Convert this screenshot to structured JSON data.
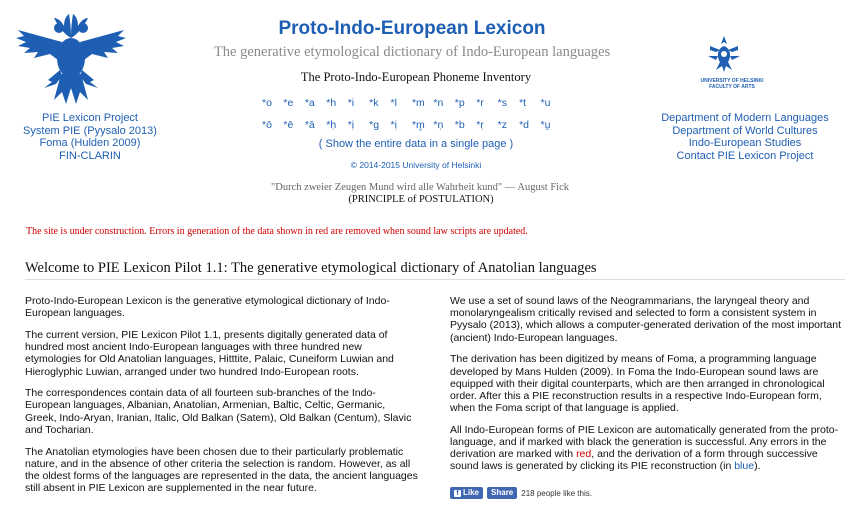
{
  "header": {
    "title": "Proto-Indo-European Lexicon",
    "subtitle": "The generative etymological dictionary of Indo-European languages",
    "inventory_title": "The Proto-Indo-European Phoneme Inventory",
    "phonemes_row1": [
      "*o",
      "*e",
      "*a",
      "*h",
      "*i",
      "*k",
      "*l",
      "*m",
      "*n",
      "*p",
      "*r",
      "*s",
      "*t",
      "*u"
    ],
    "phonemes_row2": [
      "*ō",
      "*ē",
      "*ā",
      "*ḥ",
      "*ị",
      "*g",
      "*ị",
      "*m̥",
      "*ṇ",
      "*b",
      "*ṛ",
      "*z",
      "*d",
      "*u̯"
    ],
    "show_all": "( Show the entire data in a single page )",
    "copyright": "© 2014-2015 University of Helsinki",
    "quote": "\"Durch zweier Zeugen Mund wird alle Wahrheit kund\" — August Fick",
    "principle": "(PRINCIPLE of POSTULATION)"
  },
  "left_links": [
    "PIE Lexicon Project",
    "System PIE (Pyysalo 2013)",
    "Foma (Hulden 2009)",
    "FIN-CLARIN"
  ],
  "right_logo": {
    "line1": "UNIVERSITY OF HELSINKI",
    "line2": "FACULTY OF ARTS"
  },
  "right_links": [
    "Department of Modern Languages",
    "Department of World Cultures",
    "Indo-European Studies",
    "Contact PIE Lexicon Project"
  ],
  "notice": "The site is under construction. Errors in generation of the data shown in red are removed when sound law scripts are updated.",
  "welcome_title": "Welcome to PIE Lexicon Pilot 1.1: The generative etymological dictionary of Anatolian languages",
  "left_paragraphs": [
    "Proto-Indo-European Lexicon is the generative etymological dictionary of Indo-European languages.",
    "The current version, PIE Lexicon Pilot 1.1, presents digitally generated data of hundred most ancient Indo-European languages with three hundred new etymologies for Old Anatolian languages, Hitttite, Palaic, Cuneiform Luwian and Hieroglyphic Luwian, arranged under two hundred Indo-European roots.",
    "The correspondences contain data of all fourteen sub-branches of the Indo-European languages, Albanian, Anatolian, Armenian, Baltic, Celtic, Germanic, Greek, Indo-Aryan, Iranian, Italic, Old Balkan (Satem), Old Balkan (Centum), Slavic and Tocharian.",
    "The Anatolian etymologies have been chosen due to their particularly problematic nature, and in the absence of other criteria the selection is random. However, as all the oldest forms of the languages are represented in the data, the ancient languages still absent in PIE Lexicon are supplemented in the near future."
  ],
  "right_paragraphs": [
    "We use a set of sound laws of the Neogrammarians, the laryngeal theory and monolaryngealism critically revised and selected to form a consistent system in Pyysalo (2013), which allows a computer-generated derivation of the most important (ancient) Indo-European languages.",
    "The derivation has been digitized by means of Foma, a programming language developed by Mans Hulden (2009). In Foma the Indo-European sound laws are equipped with their digital counterparts, which are then arranged in chronological order. After this a PIE reconstruction results in a respective Indo-European form, when the Foma script of that language is applied."
  ],
  "last_paragraph": {
    "part1": "All Indo-European forms of PIE Lexicon are automatically generated from the proto-language, and if marked with black the generation is successful. Any errors in the derivation are marked with ",
    "red_word": "red",
    "part2": ", and the derivation of a form through successive sound laws is generated by clicking its PIE reconstruction (in ",
    "blue_word": "blue",
    "part3": ")."
  },
  "facebook": {
    "like_label": "Like",
    "share_label": "Share",
    "count_text": "218 people like this."
  },
  "colors": {
    "link": "#1f5fb3",
    "error": "#d00000",
    "facebook": "#4267b2"
  }
}
